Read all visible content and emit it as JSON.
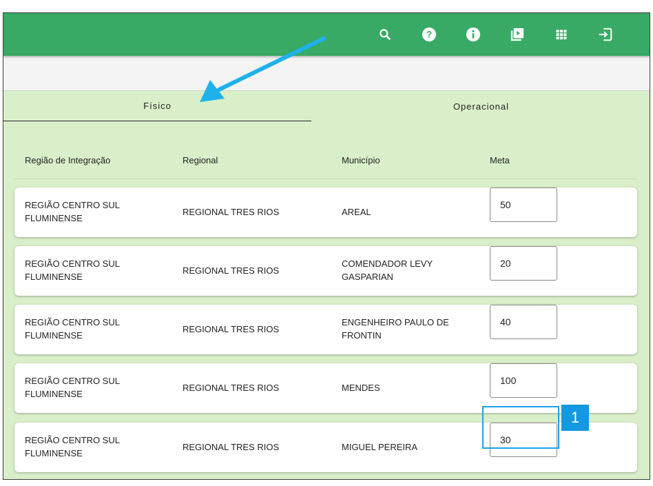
{
  "toolbar": {
    "icons": [
      "search-icon",
      "help-icon",
      "info-icon",
      "video-library-icon",
      "apps-grid-icon",
      "logout-icon"
    ],
    "brand_color": "#38aa65"
  },
  "tabs": [
    {
      "label": "Físico",
      "active": true
    },
    {
      "label": "Operacional",
      "active": false
    }
  ],
  "table": {
    "headers": [
      "Região de Integração",
      "Regional",
      "Município",
      "Meta"
    ],
    "rows": [
      {
        "regiao": "REGIÃO CENTRO SUL FLUMINENSE",
        "regional": "REGIONAL TRES RIOS",
        "municipio": "AREAL",
        "meta": "50"
      },
      {
        "regiao": "REGIÃO CENTRO SUL FLUMINENSE",
        "regional": "REGIONAL TRES RIOS",
        "municipio": "COMENDADOR LEVY GASPARIAN",
        "meta": "20"
      },
      {
        "regiao": "REGIÃO CENTRO SUL FLUMINENSE",
        "regional": "REGIONAL TRES RIOS",
        "municipio": "ENGENHEIRO PAULO DE FRONTIN",
        "meta": "40"
      },
      {
        "regiao": "REGIÃO CENTRO SUL FLUMINENSE",
        "regional": "REGIONAL TRES RIOS",
        "municipio": "MENDES",
        "meta": "100"
      },
      {
        "regiao": "REGIÃO CENTRO SUL FLUMINENSE",
        "regional": "REGIONAL TRES RIOS",
        "municipio": "MIGUEL PEREIRA",
        "meta": "30"
      }
    ]
  },
  "annotation": {
    "badge_label": "1",
    "highlight_color": "#1aa3e8"
  }
}
